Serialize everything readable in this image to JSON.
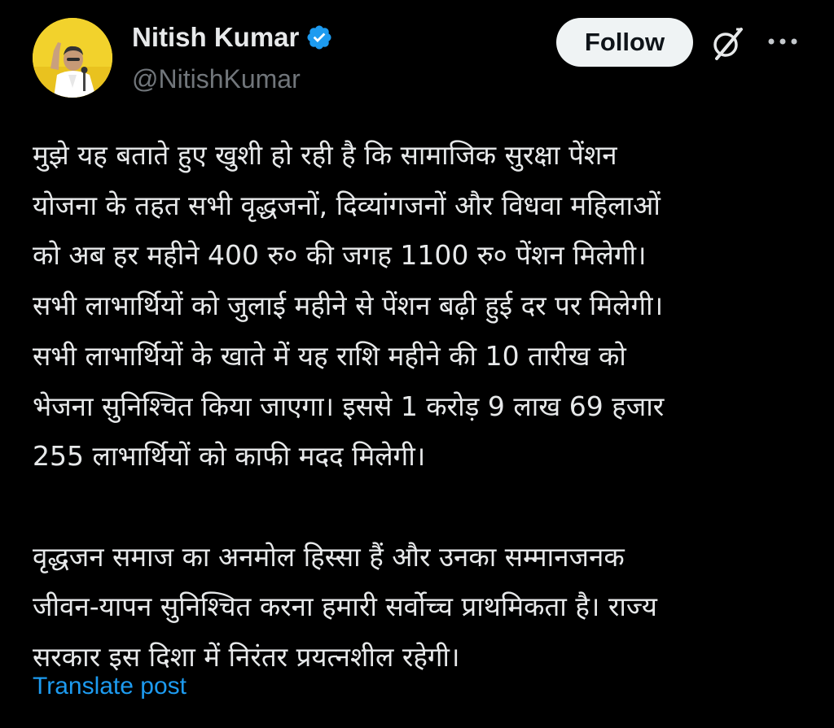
{
  "author": {
    "display_name": "Nitish Kumar",
    "handle": "@NitishKumar",
    "verified": true,
    "avatar_icon": "profile-photo"
  },
  "actions": {
    "follow_label": "Follow",
    "grok_icon": "grok-icon",
    "more_icon": "more-options-icon"
  },
  "post": {
    "lines": [
      "मुझे यह बताते हुए खुशी हो रही है कि सामाजिक सुरक्षा पेंशन",
      "योजना के तहत सभी वृद्धजनों, दिव्यांगजनों और विधवा महिलाओं",
      "को अब हर महीने 400 रु० की जगह 1100 रु० पेंशन मिलेगी।",
      "सभी लाभार्थियों को जुलाई महीने से पेंशन बढ़ी हुई दर पर मिलेगी।",
      "सभी लाभार्थियों के खाते में यह राशि महीने की 10 तारीख को",
      "भेजना सुनिश्चित किया जाएगा। इससे 1 करोड़ 9 लाख 69 हजार",
      "255 लाभार्थियों को काफी मदद मिलेगी।",
      "वृद्धजन समाज का अनमोल हिस्सा हैं और उनका सम्मानजनक",
      "जीवन-यापन सुनिश्चित करना हमारी सर्वोच्च प्राथमिकता है। राज्य",
      "सरकार इस दिशा में निरंतर प्रयत्नशील रहेगी।"
    ],
    "translate_label": "Translate post"
  },
  "colors": {
    "background": "#000000",
    "text": "#e7e9ea",
    "secondary_text": "#71767b",
    "link": "#1d9bf0",
    "verified_badge": "#1d9bf0",
    "follow_button_bg": "#eff3f4"
  }
}
